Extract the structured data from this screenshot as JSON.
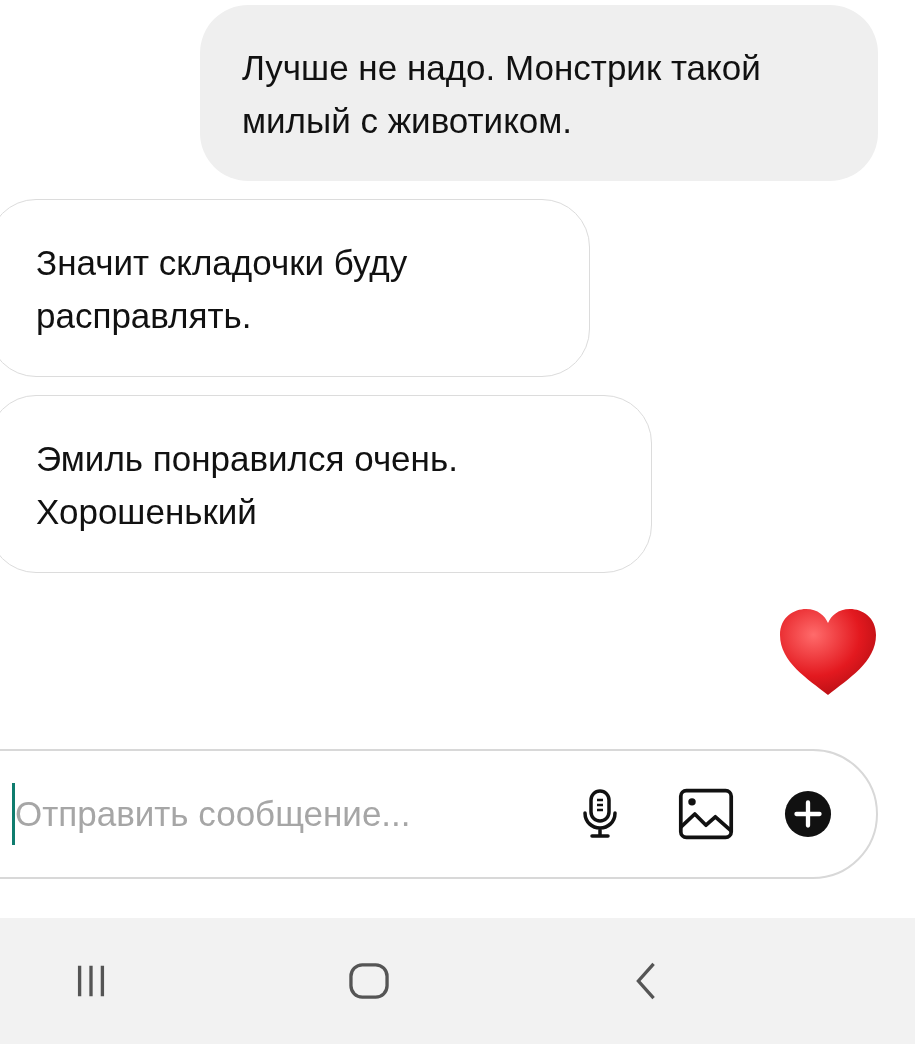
{
  "messages": [
    {
      "kind": "outgoing",
      "text": "Лучше не надо. Монстрик такой милый с животиком."
    },
    {
      "kind": "incoming",
      "text": "Значит складочки буду расправлять."
    },
    {
      "kind": "incoming",
      "text": "Эмиль понравился очень. Хорошенький"
    },
    {
      "kind": "heart"
    }
  ],
  "composer": {
    "placeholder": "Отправить сообщение..."
  }
}
